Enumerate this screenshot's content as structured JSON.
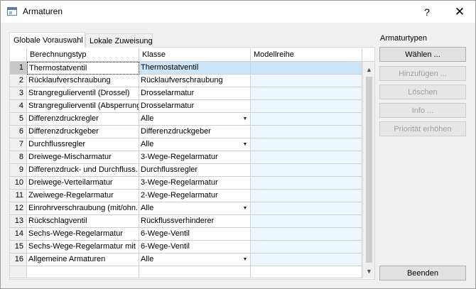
{
  "window": {
    "title": "Armaturen",
    "help_label": "?",
    "close_label": "✕"
  },
  "tabs": [
    {
      "label": "Globale Vorauswahl",
      "active": true
    },
    {
      "label": "Lokale Zuweisung",
      "active": false
    }
  ],
  "grid": {
    "columns": [
      "Berechnungstyp",
      "Klasse",
      "Modellreihe"
    ],
    "rows": [
      {
        "num": "1",
        "typ": "Thermostatventil",
        "klasse": "Thermostatventil",
        "modell": "",
        "dropdown": false
      },
      {
        "num": "2",
        "typ": "Rücklaufverschraubung",
        "klasse": "Rücklaufverschraubung",
        "modell": "",
        "dropdown": false
      },
      {
        "num": "3",
        "typ": "Strangregulierventil (Drossel)",
        "klasse": "Drosselarmatur",
        "modell": "",
        "dropdown": false
      },
      {
        "num": "4",
        "typ": "Strangregulierventil (Absperrung)",
        "klasse": "Drosselarmatur",
        "modell": "",
        "dropdown": false
      },
      {
        "num": "5",
        "typ": "Differenzdruckregler",
        "klasse": "Alle",
        "modell": "",
        "dropdown": true
      },
      {
        "num": "6",
        "typ": "Differenzdruckgeber",
        "klasse": "Differenzdruckgeber",
        "modell": "",
        "dropdown": false
      },
      {
        "num": "7",
        "typ": "Durchflussregler",
        "klasse": "Alle",
        "modell": "",
        "dropdown": true
      },
      {
        "num": "8",
        "typ": "Dreiwege-Mischarmatur",
        "klasse": "3-Wege-Regelarmatur",
        "modell": "",
        "dropdown": false
      },
      {
        "num": "9",
        "typ": "Differenzdruck- und Durchfluss...",
        "klasse": "Durchflussregler",
        "modell": "",
        "dropdown": false
      },
      {
        "num": "10",
        "typ": "Dreiwege-Verteilarmatur",
        "klasse": "3-Wege-Regelarmatur",
        "modell": "",
        "dropdown": false
      },
      {
        "num": "11",
        "typ": "Zweiwege-Regelarmatur",
        "klasse": "2-Wege-Regelarmatur",
        "modell": "",
        "dropdown": false
      },
      {
        "num": "12",
        "typ": "Einrohrverschraubung (mit/ohn...",
        "klasse": "Alle",
        "modell": "",
        "dropdown": true
      },
      {
        "num": "13",
        "typ": "Rückschlagventil",
        "klasse": "Rückflussverhinderer",
        "modell": "",
        "dropdown": false
      },
      {
        "num": "14",
        "typ": "Sechs-Wege-Regelarmatur",
        "klasse": "6-Wege-Ventil",
        "modell": "",
        "dropdown": false
      },
      {
        "num": "15",
        "typ": "Sechs-Wege-Regelarmatur mit ...",
        "klasse": "6-Wege-Ventil",
        "modell": "",
        "dropdown": false
      },
      {
        "num": "16",
        "typ": "Allgemeine Armaturen",
        "klasse": "Alle",
        "modell": "",
        "dropdown": true
      }
    ]
  },
  "side": {
    "label": "Armaturtypen",
    "waehlen": "Wählen ...",
    "hinzufuegen": "Hinzufügen ...",
    "loeschen": "Löschen",
    "info": "Info ...",
    "prioritaet": "Priorität erhöhen",
    "beenden": "Beenden"
  },
  "icons": {
    "scroll_up": "scroll-up-arrow-icon",
    "scroll_down": "scroll-down-arrow-icon",
    "dropdown": "dropdown-arrow-icon"
  },
  "colors": {
    "selection": "#cce4f7",
    "modell_column": "#eef6fd",
    "disabled_text": "#a0a0a0"
  }
}
